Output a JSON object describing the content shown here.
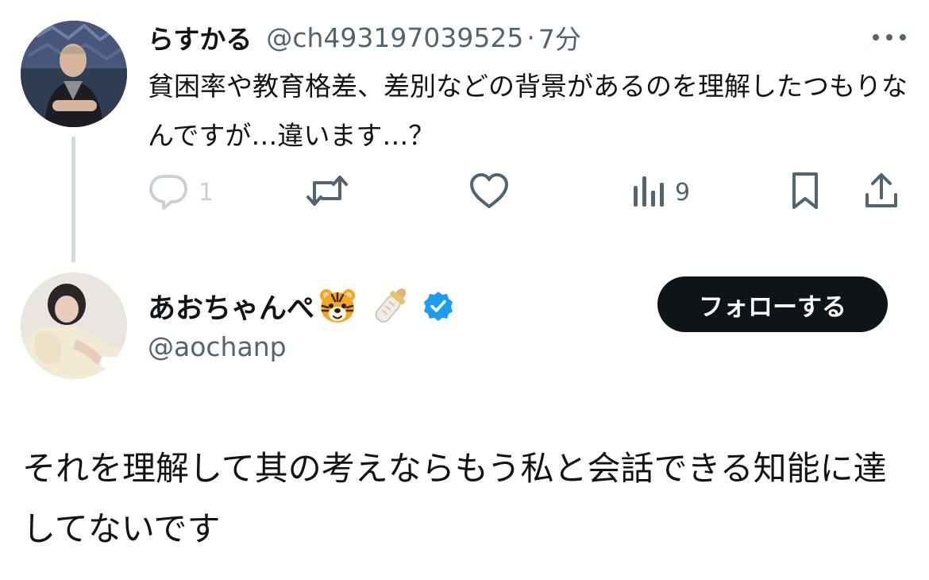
{
  "reply": {
    "display_name": "らすかる",
    "handle": "@ch493197039525",
    "separator": "·",
    "time": "7分",
    "text": "貧困率や教育格差、差別などの背景があるのを理解したつもりなんですが…違います…？",
    "actions": {
      "reply_count": "1",
      "views_count": "9"
    }
  },
  "profile": {
    "display_name": "あおちゃんぺ",
    "emoji_1": "tiger-face-emoji",
    "emoji_2": "baby-bottle-emoji",
    "verified_badge": "verified-check-icon",
    "handle": "@aochanp",
    "follow_label": "フォローする"
  },
  "post": {
    "text": "それを理解して其の考えならもう私と会話できる知能に達してないです"
  },
  "colors": {
    "text_primary": "#0f1419",
    "text_secondary": "#536471",
    "verified": "#1d9bf0",
    "button_bg": "#0f1419",
    "thread_line": "#cfd9de"
  }
}
